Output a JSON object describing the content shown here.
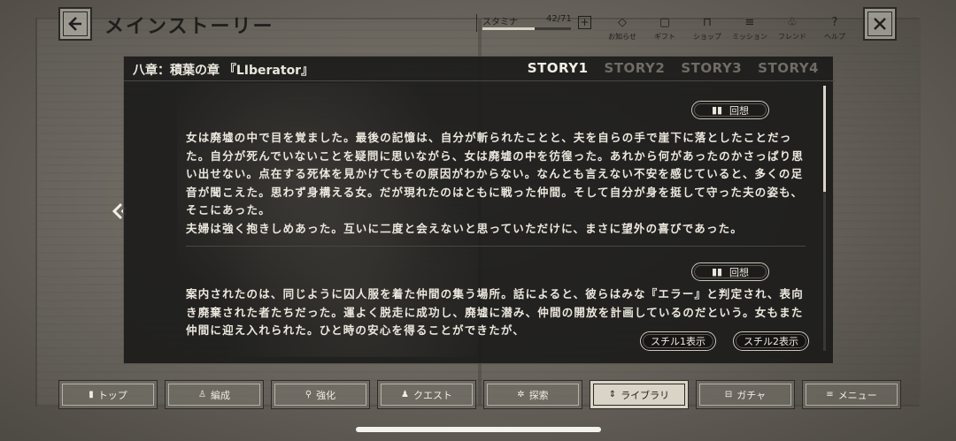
{
  "app": {
    "title": "メインストーリー"
  },
  "stamina": {
    "label": "スタミナ",
    "value": "42/71",
    "fraction": 0.59,
    "plus_label": "+"
  },
  "top_nav": [
    {
      "icon": "◇",
      "label": "お知らせ"
    },
    {
      "icon": "▢",
      "label": "ギフト"
    },
    {
      "icon": "⊓",
      "label": "ショップ"
    },
    {
      "icon": "≡",
      "label": "ミッション"
    },
    {
      "icon": "♧",
      "label": "フレンド"
    },
    {
      "icon": "?",
      "label": "ヘルプ"
    }
  ],
  "chapter": {
    "title": "八章：積葉の章 『LIberator』"
  },
  "story_tabs": [
    "STORY1",
    "STORY2",
    "STORY3",
    "STORY4"
  ],
  "recall_label": "回想",
  "passages": [
    {
      "text": "女は廃墟の中で目を覚ました。最後の記憶は、自分が斬られたことと、夫を自らの手で崖下に落としたことだった。自分が死んでいないことを疑問に思いながら、女は廃墟の中を彷徨った。あれから何があったのかさっぱり思い出せない。点在する死体を見かけてもその原因がわからない。なんとも言えない不安を感じていると、多くの足音が聞こえた。思わず身構える女。だが現れたのはともに戦った仲間。そして自分が身を挺して守った夫の姿も、そこにあった。\n夫婦は強く抱きしめあった。互いに二度と会えないと思っていただけに、まさに望外の喜びであった。"
    },
    {
      "text": "案内されたのは、同じように囚人服を着た仲間の集う場所。話によると、彼らはみな『エラー』と判定され、表向き廃棄された者たちだった。運よく脱走に成功し、廃墟に潜み、仲間の開放を計画しているのだという。女もまた仲間に迎え入れられた。ひと時の安心を得ることができたが、"
    }
  ],
  "still_buttons": [
    "スチル1表示",
    "スチル2表示"
  ],
  "bottom_nav": [
    {
      "icon": "▮",
      "label": "トップ"
    },
    {
      "icon": "♙",
      "label": "編成"
    },
    {
      "icon": "⚲",
      "label": "強化"
    },
    {
      "icon": "♟",
      "label": "クエスト"
    },
    {
      "icon": "✲",
      "label": "探索"
    },
    {
      "icon": "⇕",
      "label": "ライブラリ",
      "active": true
    },
    {
      "icon": "⊟",
      "label": "ガチャ"
    },
    {
      "icon": "≡",
      "label": "メニュー"
    }
  ]
}
